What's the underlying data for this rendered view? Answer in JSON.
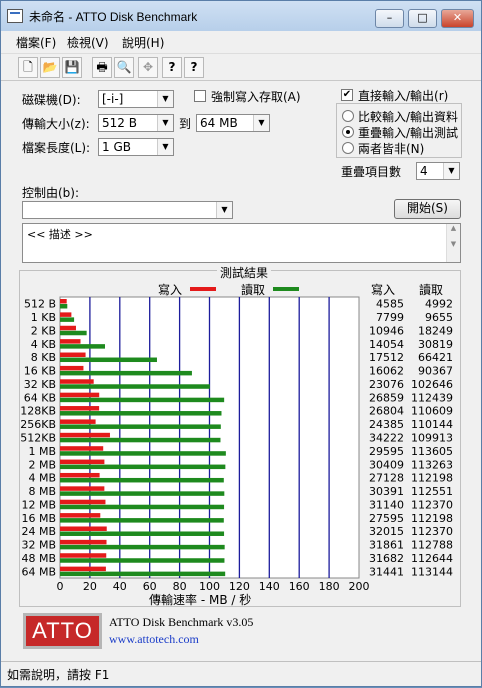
{
  "window": {
    "title": "未命名 - ATTO Disk Benchmark"
  },
  "caption_buttons": {
    "minimize": "–",
    "maximize": "□",
    "close": "✕"
  },
  "menu": [
    "檔案(F)",
    "檢視(V)",
    "說明(H)"
  ],
  "toolbar_icons": [
    "new-icon",
    "open-icon",
    "save-icon",
    "print-icon",
    "print-preview-icon",
    "move-icon",
    "help-icon",
    "context-help-icon"
  ],
  "toolbar_glyphs": [
    "🗋",
    "📂",
    "💾",
    "🖶",
    "🔍",
    "✥",
    "?",
    "?"
  ],
  "settings": {
    "drive_label": "磁碟機(D):",
    "drive_value": "[-i-]",
    "force_write_label": "強制寫入存取(A)",
    "force_write_checked": false,
    "transfer_label": "傳輸大小(z):",
    "transfer_from": "512 B",
    "to_label": "到",
    "transfer_to": "64 MB",
    "length_label": "檔案長度(L):",
    "length_value": "1 GB",
    "direct_io_label": "直接輸入/輸出(r)",
    "direct_io_checked": true,
    "direct_io_mark": "✔",
    "radio_compare": "比較輸入/輸出資料",
    "radio_overlap": "重疊輸入/輸出測試",
    "radio_neither": "兩者皆非(N)",
    "queue_label": "重疊項目數",
    "queue_value": "4",
    "control_label": "控制由(b):",
    "control_value": "",
    "start_button": "開始(S)",
    "description": "<< 描述 >>"
  },
  "results": {
    "title": "測試結果",
    "legend_write": "寫入",
    "legend_read": "讀取",
    "col_write": "寫入",
    "col_read": "讀取",
    "write_color": "#e41a1a",
    "read_color": "#1e8a1e",
    "xlabel": "傳輸速率 - MB / 秒"
  },
  "chart_data": {
    "type": "bar",
    "orientation": "horizontal",
    "title": "測試結果",
    "xlabel": "傳輸速率 - MB / 秒",
    "xlim": [
      0,
      200
    ],
    "xticks": [
      0,
      20,
      40,
      60,
      80,
      100,
      120,
      140,
      160,
      180,
      200
    ],
    "categories": [
      "512 B",
      "1 KB",
      "2 KB",
      "4 KB",
      "8 KB",
      "16 KB",
      "32 KB",
      "64 KB",
      "128KB",
      "256KB",
      "512KB",
      "1 MB",
      "2 MB",
      "4 MB",
      "8 MB",
      "12 MB",
      "16 MB",
      "24 MB",
      "32 MB",
      "48 MB",
      "64 MB"
    ],
    "series": [
      {
        "name": "寫入",
        "color": "#e41a1a",
        "values": [
          4585,
          7799,
          10946,
          14054,
          17512,
          16062,
          23076,
          26859,
          26804,
          24385,
          34222,
          29595,
          30409,
          27128,
          30391,
          31140,
          27595,
          32015,
          31861,
          31682,
          31441
        ]
      },
      {
        "name": "讀取",
        "color": "#1e8a1e",
        "values": [
          4992,
          9655,
          18249,
          30819,
          66421,
          90367,
          102646,
          112439,
          110609,
          110144,
          109913,
          113605,
          113263,
          112198,
          112551,
          112370,
          112198,
          112370,
          112788,
          112644,
          113144
        ]
      }
    ],
    "value_units": "KB/s"
  },
  "footer": {
    "logo_text": "ATTO",
    "product": "ATTO Disk Benchmark v3.05",
    "url": "www.attotech.com",
    "status": "如需說明，請按 F1"
  }
}
